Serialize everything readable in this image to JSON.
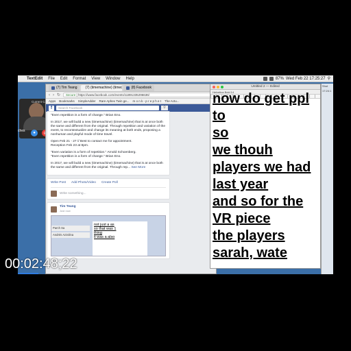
{
  "menubar": {
    "app": "TextEdit",
    "items": [
      "File",
      "Edit",
      "Format",
      "View",
      "Window",
      "Help"
    ],
    "clock": "Wed Feb 22  17:25:27",
    "battery": "87%"
  },
  "call": {
    "label": "Current Call",
    "side_text": "ches"
  },
  "browser": {
    "tabs": [
      "(7) Tim Teang",
      "(7) (timemachine) (timecha...",
      "(8) Facebook"
    ],
    "secure_label": "Secure",
    "url": "https://www.facebook.com/events/11891335296636/",
    "bookmarks": [
      "Apps",
      "Bookmarks",
      "SimpleAdder",
      "Rare Aphex Twin ge...",
      "m o n k - p r e p h e t",
      "The Actu..."
    ],
    "search_placeholder": "Search Facebook"
  },
  "post": {
    "paragraphs": [
      "\"Even repetition is a form of change.\" Brian Eno.",
      "In 2017, we will build a new (timemachine) (timemachine) that is at once both the same and different from the original. Through repetition and variation of the event, to recontextualize and change its meaning at both ends, proposing a nonhuman and playful mode of time travel.",
      "Open Feb 21 - 27 // Best to contact me for appointment.\nReception Feb 23 at 8pm.",
      "\"Even variation is a form of repetition.\" Arnold Schoenberg.\n\"Even repetition is a form of change.\" Brian Eno.",
      "In 2017, we will build a new (timemachine) (timemachine) that is at once both the same and different from the original. Through rep..."
    ],
    "see_more": "See More"
  },
  "composer": {
    "write_post": "Write Post",
    "add_photo": "Add Photo/Video",
    "create_poll": "Create Poll",
    "placeholder": "Write something..."
  },
  "feed_post": {
    "author": "Tim Teang",
    "time": "Just now",
    "inner_lines": [
      "not just a as",
      "so that was 1",
      "thing",
      "it was a also"
    ],
    "inner_names": [
      "Parch Sa",
      "Andrés Azzolina"
    ]
  },
  "textedit": {
    "title": "Untitled 2 — Edited",
    "toolbar": "Helvetica   Bold   14",
    "lines": [
      "now do get ppl",
      "to",
      "so",
      "we thouh",
      "players we had",
      "last year",
      "and so for the",
      "VR piece",
      "the players",
      "sarah, wate"
    ]
  },
  "right_window": {
    "labels": [
      "Shut",
      "17:24:1"
    ]
  },
  "overlay": {
    "timecode": "00:02:48;22"
  }
}
